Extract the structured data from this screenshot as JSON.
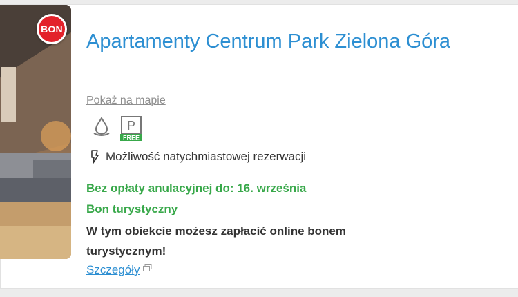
{
  "listing": {
    "badge": "BON",
    "title": "Apartamenty Centrum Park Zielona Góra",
    "map_link": "Pokaż na mapie",
    "amenities": [
      {
        "icon": "water-drop-icon"
      },
      {
        "icon": "parking-icon",
        "label": "P",
        "tag": "FREE"
      }
    ],
    "instant_booking": {
      "icon": "lightning-bolt-icon",
      "text": "Możliwość natychmiastowej rezerwacji"
    },
    "free_cancellation": "Bez opłaty anulacyjnej do: 16. września",
    "bon_label": "Bon turystyczny",
    "bon_description": "W tym obiekcie możesz zapłacić online bonem turystycznym!",
    "details_link": "Szczegóły",
    "colors": {
      "title": "#2d8fd2",
      "green": "#38a84a",
      "badge_red": "#e3222b"
    }
  }
}
